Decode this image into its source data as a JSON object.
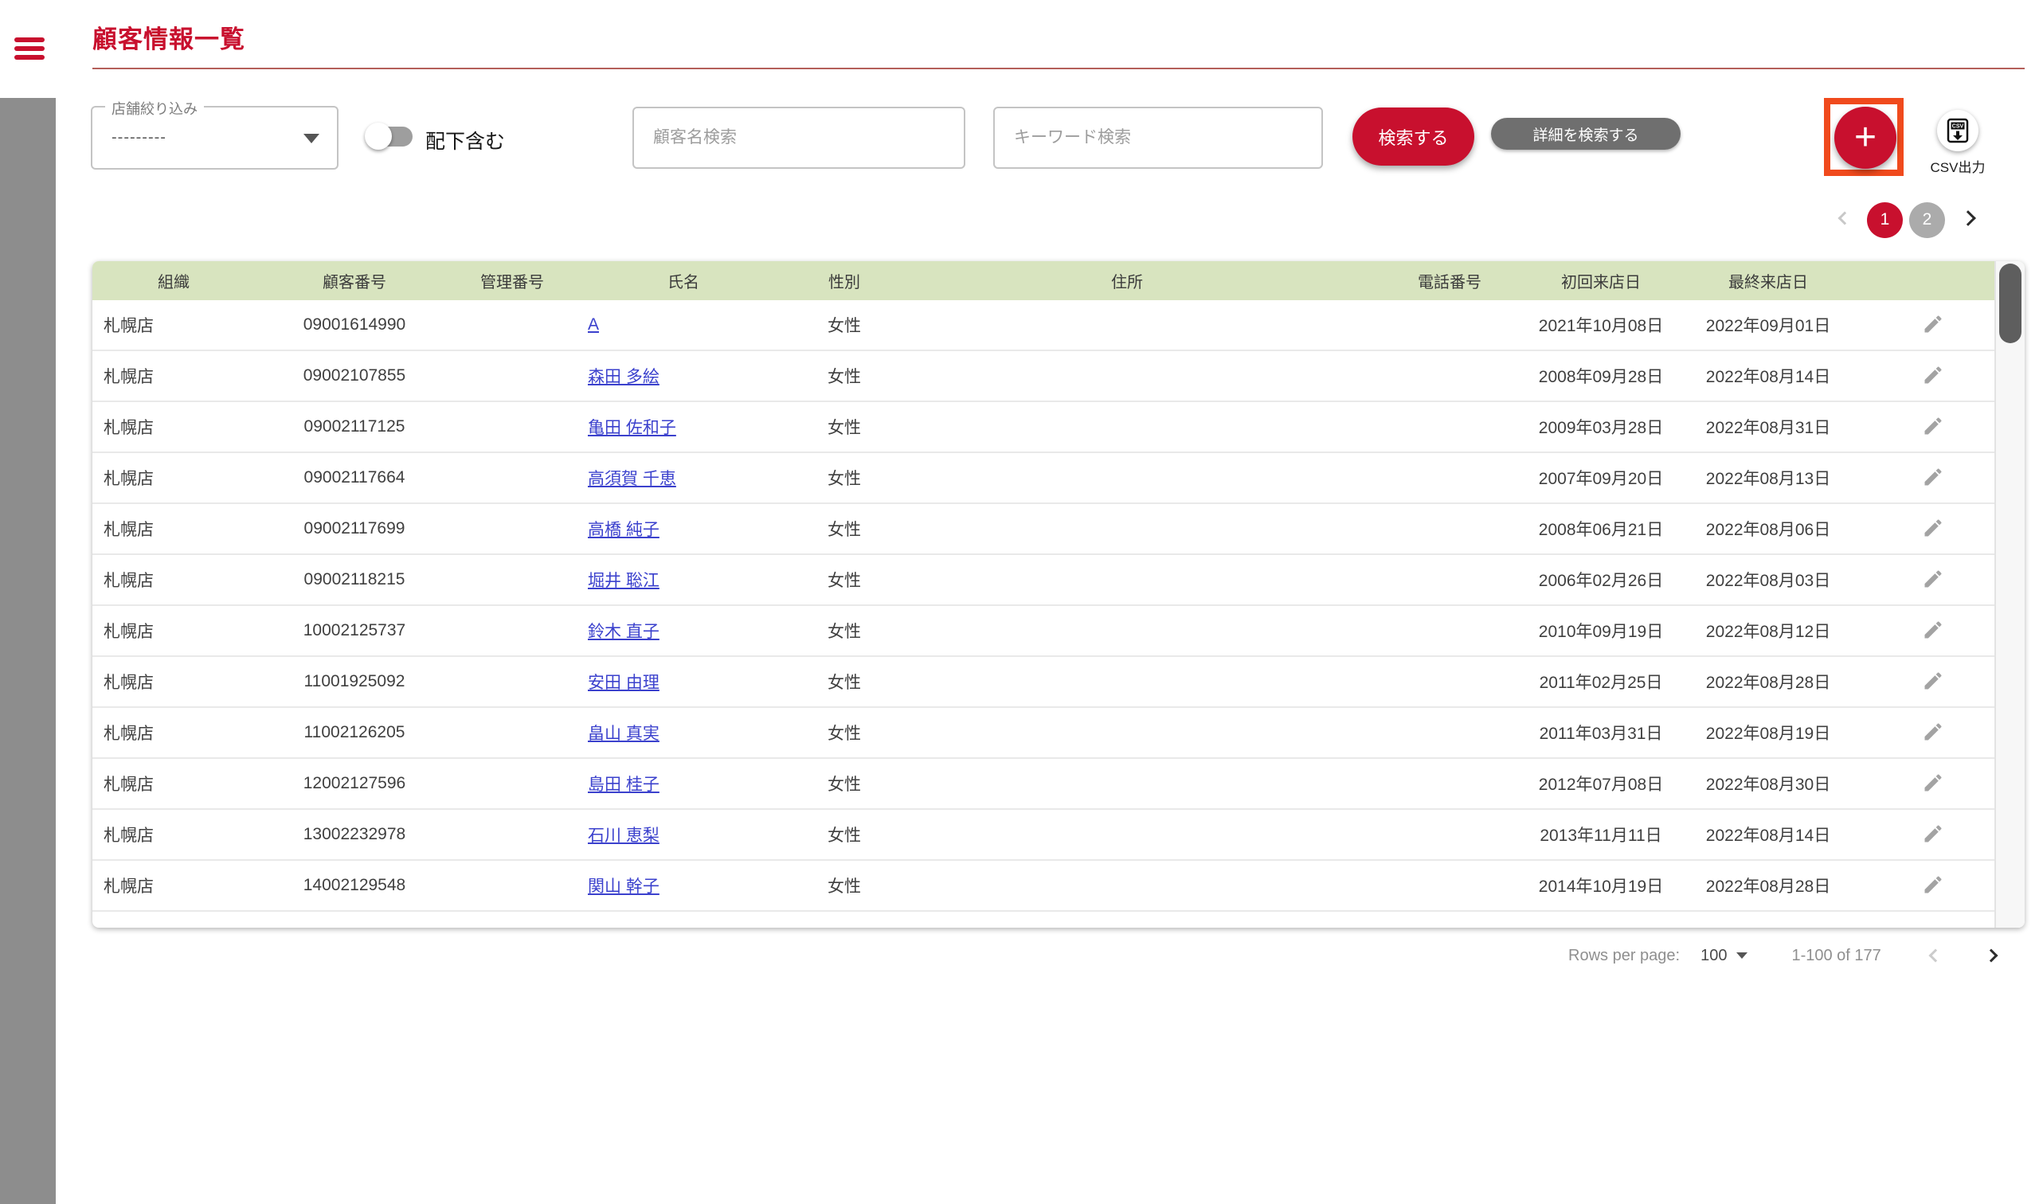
{
  "app": {
    "title": "顧客情報一覧"
  },
  "colors": {
    "accent_red": "#c8102e",
    "highlight_orange": "#f04a1d",
    "header_green": "#d8e4bf",
    "link_blue": "#3b41cd",
    "rail_gray": "#8d8d8d"
  },
  "icons": [
    "hamburger-icon",
    "dropdown-arrow-icon",
    "toggle-icon",
    "plus-icon",
    "csv-file-icon",
    "chevron-left-icon",
    "chevron-right-icon",
    "edit-pencil-icon"
  ],
  "filters": {
    "store_select": {
      "label": "店舗絞り込み",
      "value": "---------"
    },
    "subordinate_toggle": {
      "label": "配下含む",
      "state": "off"
    },
    "customer_name_search": {
      "placeholder": "顧客名検索",
      "value": ""
    },
    "keyword_search": {
      "placeholder": "キーワード検索",
      "value": ""
    },
    "search_button": "検索する",
    "detail_search_button": "詳細を検索する",
    "add_button": "+",
    "csv_button": "CSV出力"
  },
  "pagination": {
    "page1": "1",
    "page2": "2",
    "current": "1"
  },
  "table": {
    "headers": [
      "組織",
      "顧客番号",
      "管理番号",
      "氏名",
      "性別",
      "住所",
      "電話番号",
      "初回来店日",
      "最終来店日"
    ],
    "rows": [
      {
        "org": "札幌店",
        "customer_no": "09001614990",
        "mgmt_no": "",
        "name": "A",
        "gender": "女性",
        "address": "",
        "phone": "",
        "first_visit": "2021年10月08日",
        "last_visit": "2022年09月01日"
      },
      {
        "org": "札幌店",
        "customer_no": "09002107855",
        "mgmt_no": "",
        "name": "森田 多絵",
        "gender": "女性",
        "address": "",
        "phone": "",
        "first_visit": "2008年09月28日",
        "last_visit": "2022年08月14日"
      },
      {
        "org": "札幌店",
        "customer_no": "09002117125",
        "mgmt_no": "",
        "name": "亀田 佐和子",
        "gender": "女性",
        "address": "",
        "phone": "",
        "first_visit": "2009年03月28日",
        "last_visit": "2022年08月31日"
      },
      {
        "org": "札幌店",
        "customer_no": "09002117664",
        "mgmt_no": "",
        "name": "高須賀 千恵",
        "gender": "女性",
        "address": "",
        "phone": "",
        "first_visit": "2007年09月20日",
        "last_visit": "2022年08月13日"
      },
      {
        "org": "札幌店",
        "customer_no": "09002117699",
        "mgmt_no": "",
        "name": "高橋 純子",
        "gender": "女性",
        "address": "",
        "phone": "",
        "first_visit": "2008年06月21日",
        "last_visit": "2022年08月06日"
      },
      {
        "org": "札幌店",
        "customer_no": "09002118215",
        "mgmt_no": "",
        "name": "堀井 聡江",
        "gender": "女性",
        "address": "",
        "phone": "",
        "first_visit": "2006年02月26日",
        "last_visit": "2022年08月03日"
      },
      {
        "org": "札幌店",
        "customer_no": "10002125737",
        "mgmt_no": "",
        "name": "鈴木 直子",
        "gender": "女性",
        "address": "",
        "phone": "",
        "first_visit": "2010年09月19日",
        "last_visit": "2022年08月12日"
      },
      {
        "org": "札幌店",
        "customer_no": "11001925092",
        "mgmt_no": "",
        "name": "安田 由理",
        "gender": "女性",
        "address": "",
        "phone": "",
        "first_visit": "2011年02月25日",
        "last_visit": "2022年08月28日"
      },
      {
        "org": "札幌店",
        "customer_no": "11002126205",
        "mgmt_no": "",
        "name": "畠山 真実",
        "gender": "女性",
        "address": "",
        "phone": "",
        "first_visit": "2011年03月31日",
        "last_visit": "2022年08月19日"
      },
      {
        "org": "札幌店",
        "customer_no": "12002127596",
        "mgmt_no": "",
        "name": "島田 桂子",
        "gender": "女性",
        "address": "",
        "phone": "",
        "first_visit": "2012年07月08日",
        "last_visit": "2022年08月30日"
      },
      {
        "org": "札幌店",
        "customer_no": "13002232978",
        "mgmt_no": "",
        "name": "石川 恵梨",
        "gender": "女性",
        "address": "",
        "phone": "",
        "first_visit": "2013年11月11日",
        "last_visit": "2022年08月14日"
      },
      {
        "org": "札幌店",
        "customer_no": "14002129548",
        "mgmt_no": "",
        "name": "関山 幹子",
        "gender": "女性",
        "address": "",
        "phone": "",
        "first_visit": "2014年10月19日",
        "last_visit": "2022年08月28日"
      }
    ]
  },
  "footer": {
    "rows_per_page_label": "Rows per page:",
    "rows_per_page_value": "100",
    "range_label": "1-100 of 177"
  }
}
